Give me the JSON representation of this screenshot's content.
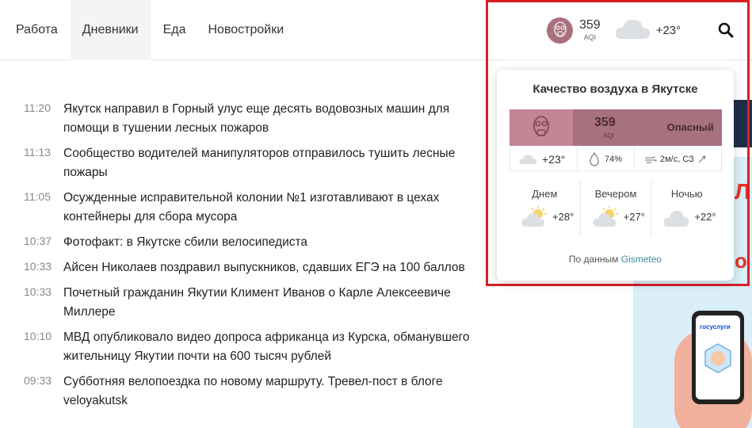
{
  "nav": {
    "items": [
      {
        "label": "Работа"
      },
      {
        "label": "Дневники"
      },
      {
        "label": "Еда"
      },
      {
        "label": "Новостройки"
      }
    ],
    "active_index": 1
  },
  "header_widget": {
    "aqi_value": "359",
    "aqi_label": "AQI",
    "temp": "+23°"
  },
  "news": [
    {
      "time": "11:20",
      "title": "Якутск направил в Горный улус еще десять водовозных машин для помощи в тушении лесных пожаров"
    },
    {
      "time": "11:13",
      "title": "Сообщество водителей манипуляторов отправилось тушить лесные пожары"
    },
    {
      "time": "11:05",
      "title": "Осужденные исправительной колонии №1 изготавливают в цехах контейнеры для сбора мусора"
    },
    {
      "time": "10:37",
      "title": "Фотофакт: в Якутске сбили велосипедиста"
    },
    {
      "time": "10:33",
      "title": "Айсен Николаев поздравил выпускников, сдавших ЕГЭ на 100 баллов"
    },
    {
      "time": "10:33",
      "title": "Почетный гражданин Якутии Климент Иванов о Карле Алексеевиче Миллере"
    },
    {
      "time": "10:10",
      "title": "МВД опубликовало видео допроса африканца из Курска, обманувшего жительницу Якутии почти на 600 тысяч рублей"
    },
    {
      "time": "09:33",
      "title": "Субботняя велопоездка по новому маршруту. Тревел-пост в блоге veloyakutsk"
    }
  ],
  "popup": {
    "title": "Качество воздуха в Якутске",
    "aqi_value": "359",
    "aqi_label": "AQI",
    "aqi_status": "Опасный",
    "temp": "+23°",
    "humidity": "74%",
    "wind": "2м/с, СЗ",
    "periods": [
      {
        "label": "Днем",
        "temp": "+28°",
        "icon": "partly-cloudy-icon"
      },
      {
        "label": "Вечером",
        "temp": "+27°",
        "icon": "partly-cloudy-icon"
      },
      {
        "label": "Ночью",
        "temp": "+22°",
        "icon": "cloud-icon"
      }
    ],
    "source_prefix": "По данным",
    "source_link": "Gismeteo"
  },
  "ad": {
    "gosuslugi": "госуслуги"
  },
  "colors": {
    "aqi_dark": "#a8717f",
    "aqi_light": "#c48597",
    "highlight": "#d62024",
    "link": "#3c8a9a"
  }
}
